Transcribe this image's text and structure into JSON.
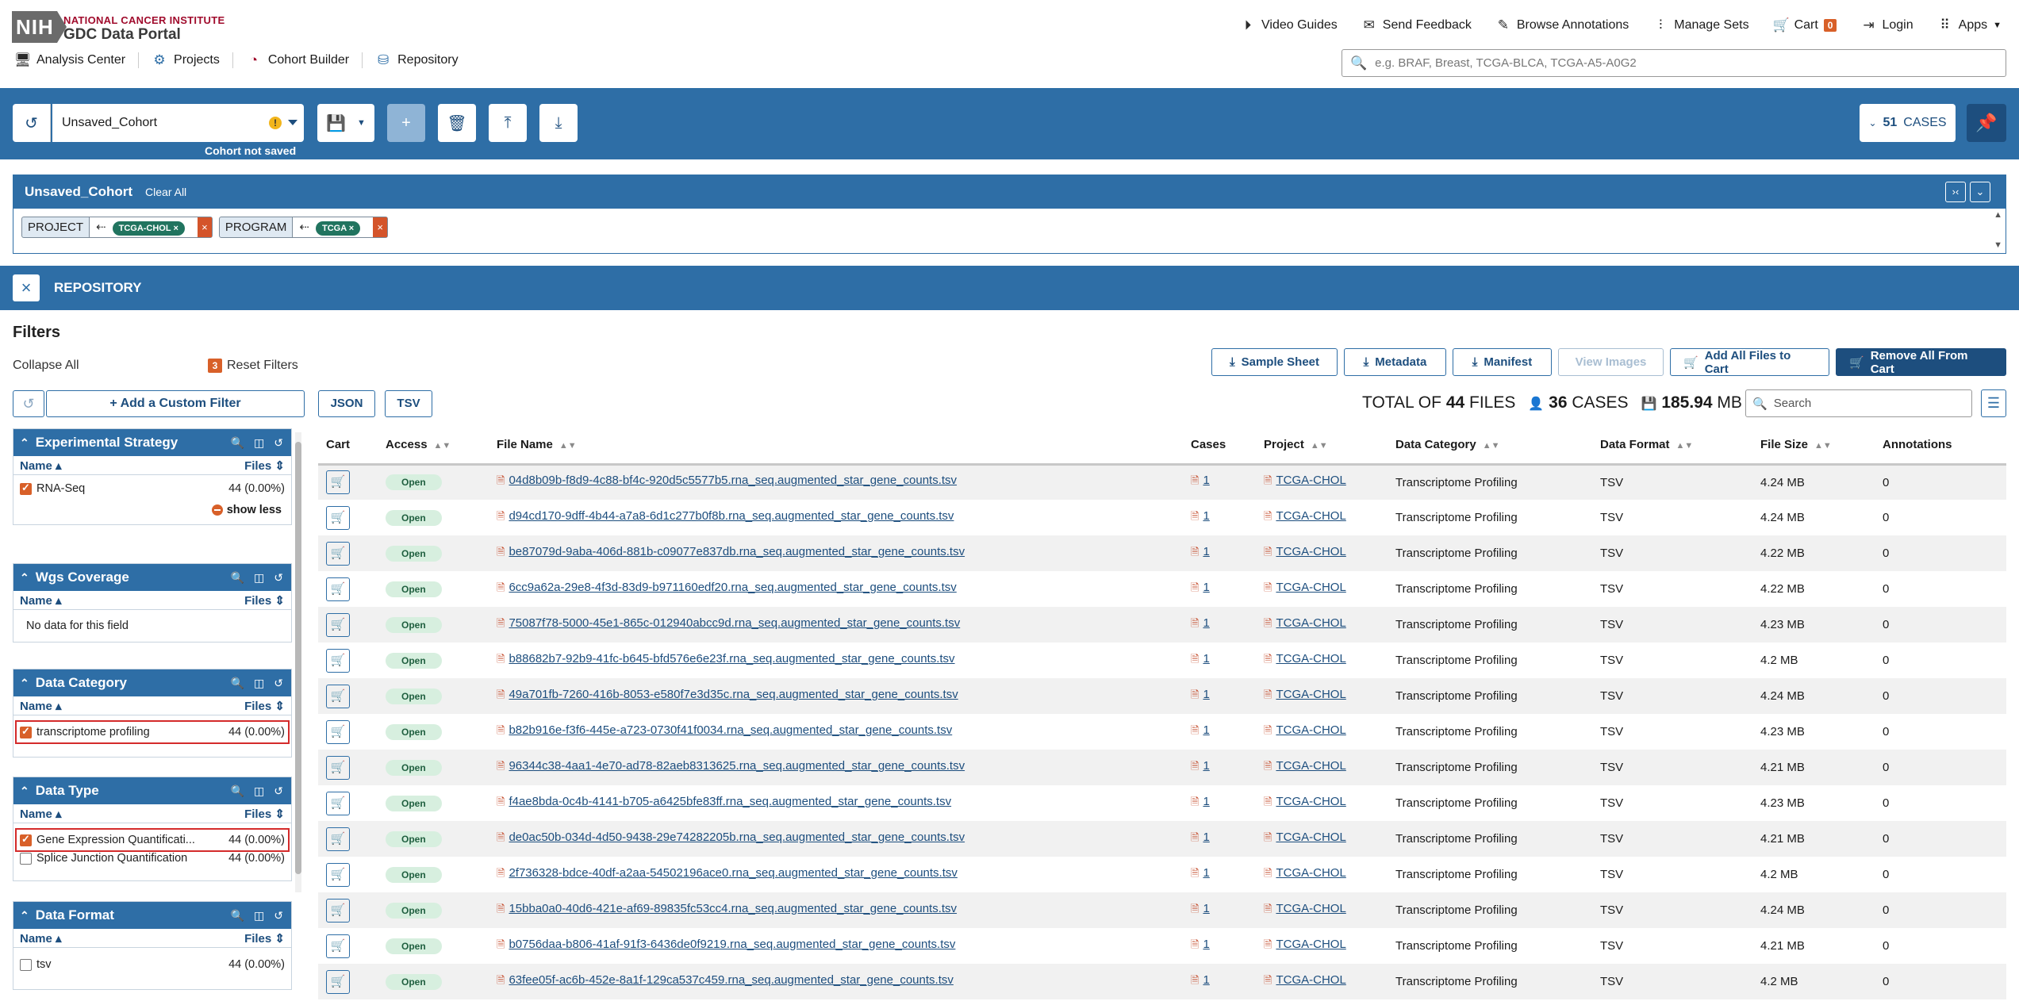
{
  "header": {
    "logo_text": "NIH",
    "institute": "NATIONAL CANCER INSTITUTE",
    "portal": "GDC Data Portal",
    "nav": [
      {
        "label": "Video Guides",
        "icon": "play-circle-icon"
      },
      {
        "label": "Send Feedback",
        "icon": "feedback-icon"
      },
      {
        "label": "Browse Annotations",
        "icon": "edit-icon"
      },
      {
        "label": "Manage Sets",
        "icon": "sliders-icon"
      },
      {
        "label": "Cart",
        "icon": "cart-icon",
        "badge": "0"
      },
      {
        "label": "Login",
        "icon": "login-icon"
      },
      {
        "label": "Apps",
        "icon": "apps-grid-icon"
      }
    ],
    "subnav": [
      {
        "label": "Analysis Center"
      },
      {
        "label": "Projects"
      },
      {
        "label": "Cohort Builder"
      },
      {
        "label": "Repository"
      }
    ],
    "search_placeholder": "e.g. BRAF, Breast, TCGA-BLCA, TCGA-A5-A0G2"
  },
  "cohort_bar": {
    "cohort_name": "Unsaved_Cohort",
    "warning_badge": "!",
    "status": "Cohort not saved",
    "cases_count": "51",
    "cases_label": "CASES"
  },
  "cohort_panel": {
    "title": "Unsaved_Cohort",
    "clear_all": "Clear All",
    "filters": [
      {
        "key": "PROJECT",
        "value": "TCGA-CHOL"
      },
      {
        "key": "PROGRAM",
        "value": "TCGA"
      }
    ]
  },
  "repository": {
    "title": "REPOSITORY",
    "filters_title": "Filters",
    "collapse_all": "Collapse All",
    "reset_count": "3",
    "reset_label": "Reset Filters",
    "add_custom_filter": "+ Add a Custom Filter",
    "facets": {
      "experimental_strategy": {
        "title": "Experimental Strategy",
        "col_name": "Name",
        "col_files": "Files",
        "rows": [
          {
            "label": "RNA-Seq",
            "count": "44 (0.00%)",
            "checked": true
          }
        ],
        "show_less": "show less"
      },
      "wgs_coverage": {
        "title": "Wgs Coverage",
        "col_name": "Name",
        "col_files": "Files",
        "empty": "No data for this field"
      },
      "data_category": {
        "title": "Data Category",
        "col_name": "Name",
        "col_files": "Files",
        "rows": [
          {
            "label": "transcriptome profiling",
            "count": "44 (0.00%)",
            "checked": true
          }
        ]
      },
      "data_type": {
        "title": "Data Type",
        "col_name": "Name",
        "col_files": "Files",
        "rows": [
          {
            "label": "Gene Expression Quantificati...",
            "count": "44 (0.00%)",
            "checked": true
          },
          {
            "label": "Splice Junction Quantification",
            "count": "44 (0.00%)",
            "checked": false
          }
        ]
      },
      "data_format": {
        "title": "Data Format",
        "col_name": "Name",
        "col_files": "Files",
        "rows": [
          {
            "label": "tsv",
            "count": "44 (0.00%)",
            "checked": false
          }
        ]
      }
    },
    "actions": {
      "sample_sheet": "Sample Sheet",
      "metadata": "Metadata",
      "manifest": "Manifest",
      "view_images": "View Images",
      "add_all": "Add All Files to Cart",
      "remove_all": "Remove All From Cart"
    },
    "export": {
      "json": "JSON",
      "tsv": "TSV"
    },
    "totals": {
      "prefix": "TOTAL OF",
      "files_count": "44",
      "files_label": "FILES",
      "cases_count": "36",
      "cases_label": "CASES",
      "size_value": "185.94",
      "size_unit": "MB"
    },
    "table_search_placeholder": "Search",
    "columns": {
      "cart": "Cart",
      "access": "Access",
      "file_name": "File Name",
      "cases": "Cases",
      "project": "Project",
      "data_category": "Data Category",
      "data_format": "Data Format",
      "file_size": "File Size",
      "annotations": "Annotations"
    },
    "rows": [
      {
        "access": "Open",
        "file": "04d8b09b-f8d9-4c88-bf4c-920d5c5577b5.rna_seq.augmented_star_gene_counts.tsv",
        "cases": "1",
        "project": "TCGA-CHOL",
        "category": "Transcriptome Profiling",
        "format": "TSV",
        "size": "4.24 MB",
        "annotations": "0"
      },
      {
        "access": "Open",
        "file": "d94cd170-9dff-4b44-a7a8-6d1c277b0f8b.rna_seq.augmented_star_gene_counts.tsv",
        "cases": "1",
        "project": "TCGA-CHOL",
        "category": "Transcriptome Profiling",
        "format": "TSV",
        "size": "4.24 MB",
        "annotations": "0"
      },
      {
        "access": "Open",
        "file": "be87079d-9aba-406d-881b-c09077e837db.rna_seq.augmented_star_gene_counts.tsv",
        "cases": "1",
        "project": "TCGA-CHOL",
        "category": "Transcriptome Profiling",
        "format": "TSV",
        "size": "4.22 MB",
        "annotations": "0"
      },
      {
        "access": "Open",
        "file": "6cc9a62a-29e8-4f3d-83d9-b971160edf20.rna_seq.augmented_star_gene_counts.tsv",
        "cases": "1",
        "project": "TCGA-CHOL",
        "category": "Transcriptome Profiling",
        "format": "TSV",
        "size": "4.22 MB",
        "annotations": "0"
      },
      {
        "access": "Open",
        "file": "75087f78-5000-45e1-865c-012940abcc9d.rna_seq.augmented_star_gene_counts.tsv",
        "cases": "1",
        "project": "TCGA-CHOL",
        "category": "Transcriptome Profiling",
        "format": "TSV",
        "size": "4.23 MB",
        "annotations": "0"
      },
      {
        "access": "Open",
        "file": "b88682b7-92b9-41fc-b645-bfd576e6e23f.rna_seq.augmented_star_gene_counts.tsv",
        "cases": "1",
        "project": "TCGA-CHOL",
        "category": "Transcriptome Profiling",
        "format": "TSV",
        "size": "4.2 MB",
        "annotations": "0"
      },
      {
        "access": "Open",
        "file": "49a701fb-7260-416b-8053-e580f7e3d35c.rna_seq.augmented_star_gene_counts.tsv",
        "cases": "1",
        "project": "TCGA-CHOL",
        "category": "Transcriptome Profiling",
        "format": "TSV",
        "size": "4.24 MB",
        "annotations": "0"
      },
      {
        "access": "Open",
        "file": "b82b916e-f3f6-445e-a723-0730f41f0034.rna_seq.augmented_star_gene_counts.tsv",
        "cases": "1",
        "project": "TCGA-CHOL",
        "category": "Transcriptome Profiling",
        "format": "TSV",
        "size": "4.23 MB",
        "annotations": "0"
      },
      {
        "access": "Open",
        "file": "96344c38-4aa1-4e70-ad78-82aeb8313625.rna_seq.augmented_star_gene_counts.tsv",
        "cases": "1",
        "project": "TCGA-CHOL",
        "category": "Transcriptome Profiling",
        "format": "TSV",
        "size": "4.21 MB",
        "annotations": "0"
      },
      {
        "access": "Open",
        "file": "f4ae8bda-0c4b-4141-b705-a6425bfe83ff.rna_seq.augmented_star_gene_counts.tsv",
        "cases": "1",
        "project": "TCGA-CHOL",
        "category": "Transcriptome Profiling",
        "format": "TSV",
        "size": "4.23 MB",
        "annotations": "0"
      },
      {
        "access": "Open",
        "file": "de0ac50b-034d-4d50-9438-29e74282205b.rna_seq.augmented_star_gene_counts.tsv",
        "cases": "1",
        "project": "TCGA-CHOL",
        "category": "Transcriptome Profiling",
        "format": "TSV",
        "size": "4.21 MB",
        "annotations": "0"
      },
      {
        "access": "Open",
        "file": "2f736328-bdce-40df-a2aa-54502196ace0.rna_seq.augmented_star_gene_counts.tsv",
        "cases": "1",
        "project": "TCGA-CHOL",
        "category": "Transcriptome Profiling",
        "format": "TSV",
        "size": "4.2 MB",
        "annotations": "0"
      },
      {
        "access": "Open",
        "file": "15bba0a0-40d6-421e-af69-89835fc53cc4.rna_seq.augmented_star_gene_counts.tsv",
        "cases": "1",
        "project": "TCGA-CHOL",
        "category": "Transcriptome Profiling",
        "format": "TSV",
        "size": "4.24 MB",
        "annotations": "0"
      },
      {
        "access": "Open",
        "file": "b0756daa-b806-41af-91f3-6436de0f9219.rna_seq.augmented_star_gene_counts.tsv",
        "cases": "1",
        "project": "TCGA-CHOL",
        "category": "Transcriptome Profiling",
        "format": "TSV",
        "size": "4.21 MB",
        "annotations": "0"
      },
      {
        "access": "Open",
        "file": "63fee05f-ac6b-452e-8a1f-129ca537c459.rna_seq.augmented_star_gene_counts.tsv",
        "cases": "1",
        "project": "TCGA-CHOL",
        "category": "Transcriptome Profiling",
        "format": "TSV",
        "size": "4.2 MB",
        "annotations": "0"
      }
    ]
  }
}
